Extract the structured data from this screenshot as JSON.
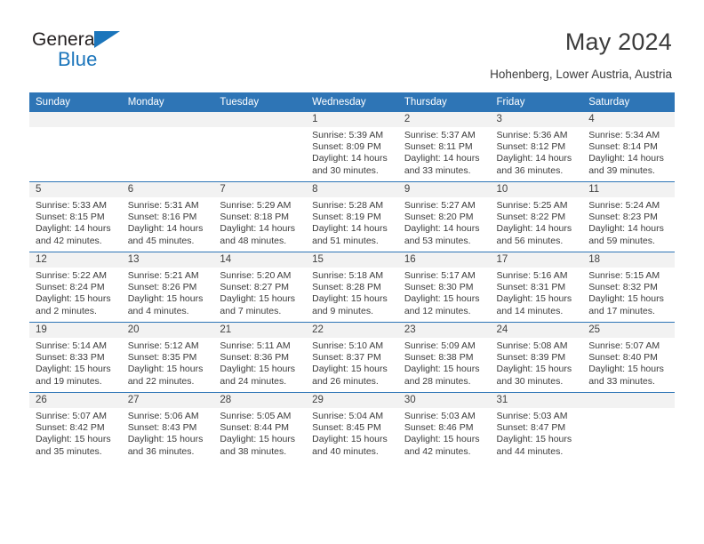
{
  "brand": {
    "name_part1": "General",
    "name_part2": "Blue"
  },
  "header": {
    "title": "May 2024",
    "subtitle": "Hohenberg, Lower Austria, Austria"
  },
  "colors": {
    "header_blue": "#2e75b6",
    "brand_blue": "#1b75bb",
    "daynum_band": "#f2f2f2",
    "text": "#3b3b3b"
  },
  "calendar": {
    "weekday_headers": [
      "Sunday",
      "Monday",
      "Tuesday",
      "Wednesday",
      "Thursday",
      "Friday",
      "Saturday"
    ],
    "weeks": [
      [
        {
          "empty": true
        },
        {
          "empty": true
        },
        {
          "empty": true
        },
        {
          "day": "1",
          "sunrise": "Sunrise: 5:39 AM",
          "sunset": "Sunset: 8:09 PM",
          "daylight": "Daylight: 14 hours and 30 minutes."
        },
        {
          "day": "2",
          "sunrise": "Sunrise: 5:37 AM",
          "sunset": "Sunset: 8:11 PM",
          "daylight": "Daylight: 14 hours and 33 minutes."
        },
        {
          "day": "3",
          "sunrise": "Sunrise: 5:36 AM",
          "sunset": "Sunset: 8:12 PM",
          "daylight": "Daylight: 14 hours and 36 minutes."
        },
        {
          "day": "4",
          "sunrise": "Sunrise: 5:34 AM",
          "sunset": "Sunset: 8:14 PM",
          "daylight": "Daylight: 14 hours and 39 minutes."
        }
      ],
      [
        {
          "day": "5",
          "sunrise": "Sunrise: 5:33 AM",
          "sunset": "Sunset: 8:15 PM",
          "daylight": "Daylight: 14 hours and 42 minutes."
        },
        {
          "day": "6",
          "sunrise": "Sunrise: 5:31 AM",
          "sunset": "Sunset: 8:16 PM",
          "daylight": "Daylight: 14 hours and 45 minutes."
        },
        {
          "day": "7",
          "sunrise": "Sunrise: 5:29 AM",
          "sunset": "Sunset: 8:18 PM",
          "daylight": "Daylight: 14 hours and 48 minutes."
        },
        {
          "day": "8",
          "sunrise": "Sunrise: 5:28 AM",
          "sunset": "Sunset: 8:19 PM",
          "daylight": "Daylight: 14 hours and 51 minutes."
        },
        {
          "day": "9",
          "sunrise": "Sunrise: 5:27 AM",
          "sunset": "Sunset: 8:20 PM",
          "daylight": "Daylight: 14 hours and 53 minutes."
        },
        {
          "day": "10",
          "sunrise": "Sunrise: 5:25 AM",
          "sunset": "Sunset: 8:22 PM",
          "daylight": "Daylight: 14 hours and 56 minutes."
        },
        {
          "day": "11",
          "sunrise": "Sunrise: 5:24 AM",
          "sunset": "Sunset: 8:23 PM",
          "daylight": "Daylight: 14 hours and 59 minutes."
        }
      ],
      [
        {
          "day": "12",
          "sunrise": "Sunrise: 5:22 AM",
          "sunset": "Sunset: 8:24 PM",
          "daylight": "Daylight: 15 hours and 2 minutes."
        },
        {
          "day": "13",
          "sunrise": "Sunrise: 5:21 AM",
          "sunset": "Sunset: 8:26 PM",
          "daylight": "Daylight: 15 hours and 4 minutes."
        },
        {
          "day": "14",
          "sunrise": "Sunrise: 5:20 AM",
          "sunset": "Sunset: 8:27 PM",
          "daylight": "Daylight: 15 hours and 7 minutes."
        },
        {
          "day": "15",
          "sunrise": "Sunrise: 5:18 AM",
          "sunset": "Sunset: 8:28 PM",
          "daylight": "Daylight: 15 hours and 9 minutes."
        },
        {
          "day": "16",
          "sunrise": "Sunrise: 5:17 AM",
          "sunset": "Sunset: 8:30 PM",
          "daylight": "Daylight: 15 hours and 12 minutes."
        },
        {
          "day": "17",
          "sunrise": "Sunrise: 5:16 AM",
          "sunset": "Sunset: 8:31 PM",
          "daylight": "Daylight: 15 hours and 14 minutes."
        },
        {
          "day": "18",
          "sunrise": "Sunrise: 5:15 AM",
          "sunset": "Sunset: 8:32 PM",
          "daylight": "Daylight: 15 hours and 17 minutes."
        }
      ],
      [
        {
          "day": "19",
          "sunrise": "Sunrise: 5:14 AM",
          "sunset": "Sunset: 8:33 PM",
          "daylight": "Daylight: 15 hours and 19 minutes."
        },
        {
          "day": "20",
          "sunrise": "Sunrise: 5:12 AM",
          "sunset": "Sunset: 8:35 PM",
          "daylight": "Daylight: 15 hours and 22 minutes."
        },
        {
          "day": "21",
          "sunrise": "Sunrise: 5:11 AM",
          "sunset": "Sunset: 8:36 PM",
          "daylight": "Daylight: 15 hours and 24 minutes."
        },
        {
          "day": "22",
          "sunrise": "Sunrise: 5:10 AM",
          "sunset": "Sunset: 8:37 PM",
          "daylight": "Daylight: 15 hours and 26 minutes."
        },
        {
          "day": "23",
          "sunrise": "Sunrise: 5:09 AM",
          "sunset": "Sunset: 8:38 PM",
          "daylight": "Daylight: 15 hours and 28 minutes."
        },
        {
          "day": "24",
          "sunrise": "Sunrise: 5:08 AM",
          "sunset": "Sunset: 8:39 PM",
          "daylight": "Daylight: 15 hours and 30 minutes."
        },
        {
          "day": "25",
          "sunrise": "Sunrise: 5:07 AM",
          "sunset": "Sunset: 8:40 PM",
          "daylight": "Daylight: 15 hours and 33 minutes."
        }
      ],
      [
        {
          "day": "26",
          "sunrise": "Sunrise: 5:07 AM",
          "sunset": "Sunset: 8:42 PM",
          "daylight": "Daylight: 15 hours and 35 minutes."
        },
        {
          "day": "27",
          "sunrise": "Sunrise: 5:06 AM",
          "sunset": "Sunset: 8:43 PM",
          "daylight": "Daylight: 15 hours and 36 minutes."
        },
        {
          "day": "28",
          "sunrise": "Sunrise: 5:05 AM",
          "sunset": "Sunset: 8:44 PM",
          "daylight": "Daylight: 15 hours and 38 minutes."
        },
        {
          "day": "29",
          "sunrise": "Sunrise: 5:04 AM",
          "sunset": "Sunset: 8:45 PM",
          "daylight": "Daylight: 15 hours and 40 minutes."
        },
        {
          "day": "30",
          "sunrise": "Sunrise: 5:03 AM",
          "sunset": "Sunset: 8:46 PM",
          "daylight": "Daylight: 15 hours and 42 minutes."
        },
        {
          "day": "31",
          "sunrise": "Sunrise: 5:03 AM",
          "sunset": "Sunset: 8:47 PM",
          "daylight": "Daylight: 15 hours and 44 minutes."
        },
        {
          "empty": true
        }
      ]
    ]
  }
}
